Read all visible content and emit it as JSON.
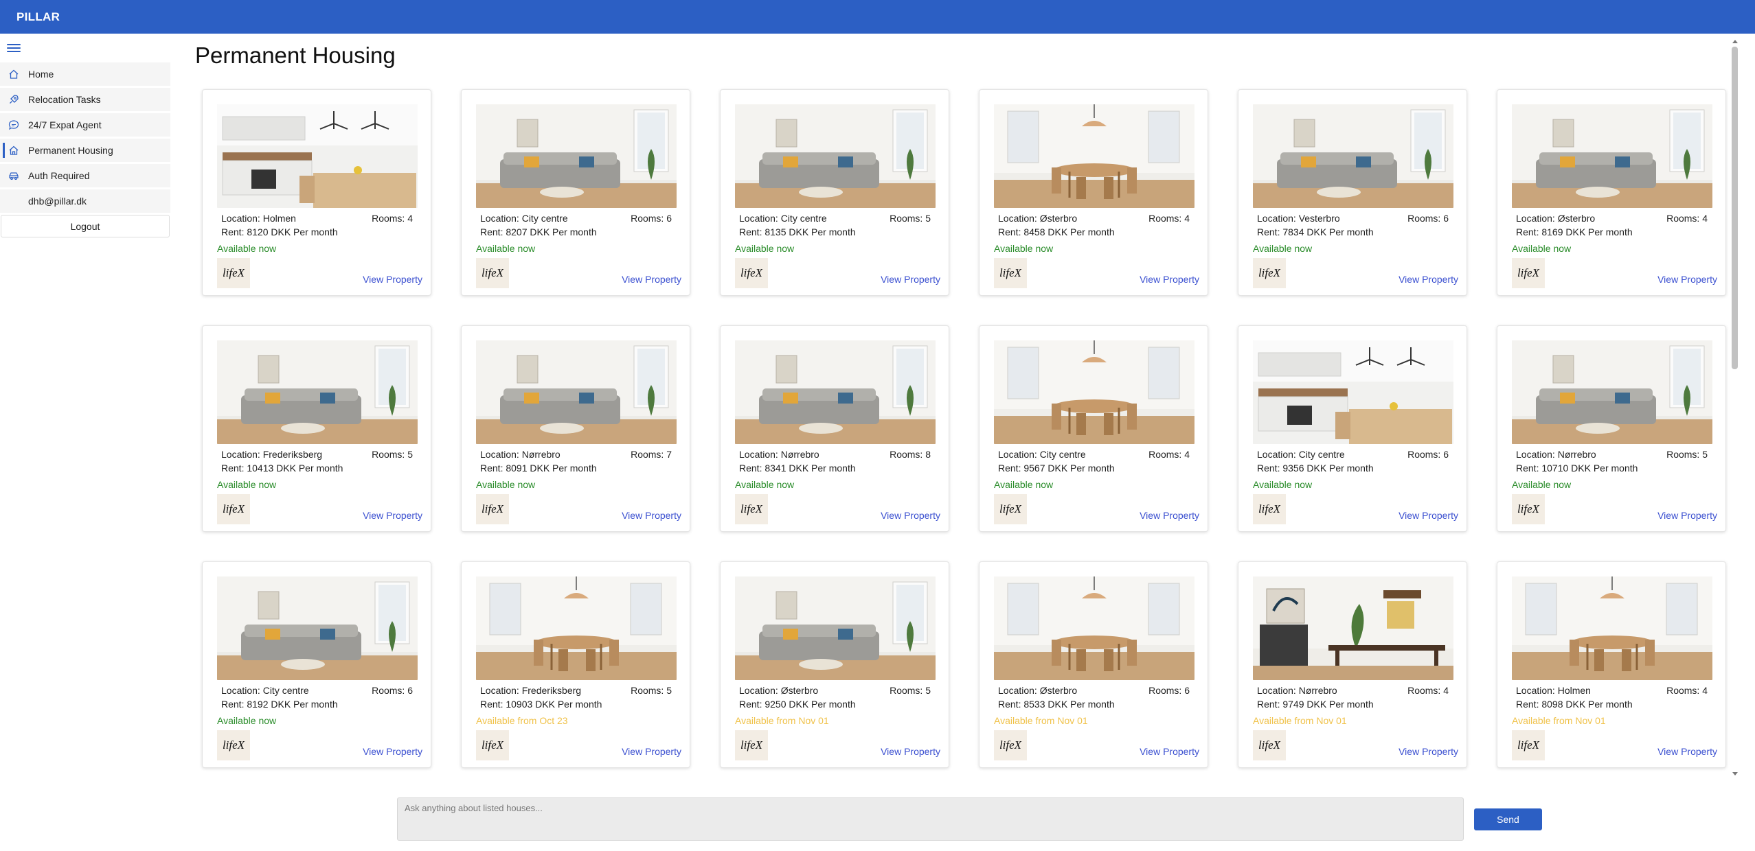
{
  "app": {
    "brand": "PILLAR"
  },
  "sidebar": {
    "items": [
      {
        "label": "Home",
        "icon": "home-icon"
      },
      {
        "label": "Relocation Tasks",
        "icon": "rocket-icon"
      },
      {
        "label": "24/7 Expat Agent",
        "icon": "chat-icon"
      },
      {
        "label": "Permanent Housing",
        "icon": "house-icon",
        "active": true
      },
      {
        "label": "Auth Required",
        "icon": "car-icon"
      }
    ],
    "user_email": "dhb@pillar.dk",
    "logout_label": "Logout"
  },
  "main": {
    "title": "Permanent Housing",
    "view_label": "View Property",
    "listings": [
      {
        "location": "Location: Holmen",
        "rooms": "Rooms: 4",
        "rent": "Rent: 8120 DKK Per month",
        "availability": "Available now",
        "status": "now",
        "provider": "lifeX",
        "scene": "kitchen"
      },
      {
        "location": "Location: City centre",
        "rooms": "Rooms: 6",
        "rent": "Rent: 8207 DKK Per month",
        "availability": "Available now",
        "status": "now",
        "provider": "lifeX",
        "scene": "living"
      },
      {
        "location": "Location: City centre",
        "rooms": "Rooms: 5",
        "rent": "Rent: 8135 DKK Per month",
        "availability": "Available now",
        "status": "now",
        "provider": "lifeX",
        "scene": "living"
      },
      {
        "location": "Location: Østerbro",
        "rooms": "Rooms: 4",
        "rent": "Rent: 8458 DKK Per month",
        "availability": "Available now",
        "status": "now",
        "provider": "lifeX",
        "scene": "dining"
      },
      {
        "location": "Location: Vesterbro",
        "rooms": "Rooms: 6",
        "rent": "Rent: 7834 DKK Per month",
        "availability": "Available now",
        "status": "now",
        "provider": "lifeX",
        "scene": "living"
      },
      {
        "location": "Location: Østerbro",
        "rooms": "Rooms: 4",
        "rent": "Rent: 8169 DKK Per month",
        "availability": "Available now",
        "status": "now",
        "provider": "lifeX",
        "scene": "living"
      },
      {
        "location": "Location: Frederiksberg",
        "rooms": "Rooms: 5",
        "rent": "Rent: 10413 DKK Per month",
        "availability": "Available now",
        "status": "now",
        "provider": "lifeX",
        "scene": "living"
      },
      {
        "location": "Location: Nørrebro",
        "rooms": "Rooms: 7",
        "rent": "Rent: 8091 DKK Per month",
        "availability": "Available now",
        "status": "now",
        "provider": "lifeX",
        "scene": "living"
      },
      {
        "location": "Location: Nørrebro",
        "rooms": "Rooms: 8",
        "rent": "Rent: 8341 DKK Per month",
        "availability": "Available now",
        "status": "now",
        "provider": "lifeX",
        "scene": "living"
      },
      {
        "location": "Location: City centre",
        "rooms": "Rooms: 4",
        "rent": "Rent: 9567 DKK Per month",
        "availability": "Available now",
        "status": "now",
        "provider": "lifeX",
        "scene": "dining"
      },
      {
        "location": "Location: City centre",
        "rooms": "Rooms: 6",
        "rent": "Rent: 9356 DKK Per month",
        "availability": "Available now",
        "status": "now",
        "provider": "lifeX",
        "scene": "kitchen"
      },
      {
        "location": "Location: Nørrebro",
        "rooms": "Rooms: 5",
        "rent": "Rent: 10710 DKK Per month",
        "availability": "Available now",
        "status": "now",
        "provider": "lifeX",
        "scene": "living"
      },
      {
        "location": "Location: City centre",
        "rooms": "Rooms: 6",
        "rent": "Rent: 8192 DKK Per month",
        "availability": "Available now",
        "status": "now",
        "provider": "lifeX",
        "scene": "living"
      },
      {
        "location": "Location: Frederiksberg",
        "rooms": "Rooms: 5",
        "rent": "Rent: 10903 DKK Per month",
        "availability": "Available from Oct 23",
        "status": "later",
        "provider": "lifeX",
        "scene": "dining"
      },
      {
        "location": "Location: Østerbro",
        "rooms": "Rooms: 5",
        "rent": "Rent: 9250 DKK Per month",
        "availability": "Available from Nov 01",
        "status": "later",
        "provider": "lifeX",
        "scene": "living"
      },
      {
        "location": "Location: Østerbro",
        "rooms": "Rooms: 6",
        "rent": "Rent: 8533 DKK Per month",
        "availability": "Available from Nov 01",
        "status": "later",
        "provider": "lifeX",
        "scene": "dining"
      },
      {
        "location": "Location: Nørrebro",
        "rooms": "Rooms: 4",
        "rent": "Rent: 9749 DKK Per month",
        "availability": "Available from Nov 01",
        "status": "later",
        "provider": "lifeX",
        "scene": "office"
      },
      {
        "location": "Location: Holmen",
        "rooms": "Rooms: 4",
        "rent": "Rent: 8098 DKK Per month",
        "availability": "Available from Nov 01",
        "status": "later",
        "provider": "lifeX",
        "scene": "dining"
      }
    ]
  },
  "chat": {
    "placeholder": "Ask anything about listed houses...",
    "send_label": "Send"
  },
  "colors": {
    "brand": "#2c5fc4",
    "available_now": "#2a8c2a",
    "available_later": "#f0c24a",
    "link": "#3a4fd0"
  }
}
